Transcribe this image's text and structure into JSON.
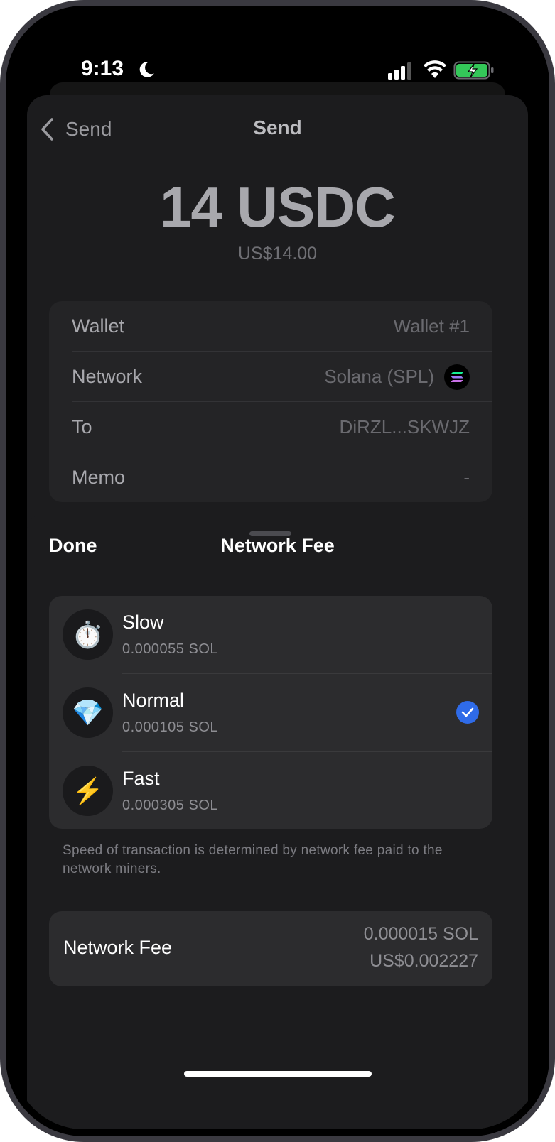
{
  "status_bar": {
    "time": "9:13"
  },
  "nav": {
    "back_label": "Send",
    "title": "Send"
  },
  "amount": {
    "value": "14 USDC",
    "fiat": "US$14.00"
  },
  "details": [
    {
      "label": "Wallet",
      "value": "Wallet #1"
    },
    {
      "label": "Network",
      "value": "Solana (SPL)"
    },
    {
      "label": "To",
      "value": "DiRZL...SKWJZ"
    },
    {
      "label": "Memo",
      "value": "-"
    }
  ],
  "fee_sheet": {
    "done_label": "Done",
    "title": "Network Fee",
    "options": [
      {
        "name": "Slow",
        "amount": "0.000055 SOL",
        "icon": "stopwatch-icon",
        "glyph": "⏱️",
        "selected": false
      },
      {
        "name": "Normal",
        "amount": "0.000105 SOL",
        "icon": "gem-icon",
        "glyph": "💎",
        "selected": true
      },
      {
        "name": "Fast",
        "amount": "0.000305 SOL",
        "icon": "lightning-icon",
        "glyph": "⚡",
        "selected": false
      }
    ],
    "hint": "Speed of transaction is determined by network fee paid to the network miners.",
    "summary": {
      "label": "Network Fee",
      "sol": "0.000015 SOL",
      "usd": "US$0.002227"
    }
  },
  "colors": {
    "accent": "#2f6be8",
    "background": "#1c1c1e",
    "card": "#2c2c2e"
  }
}
